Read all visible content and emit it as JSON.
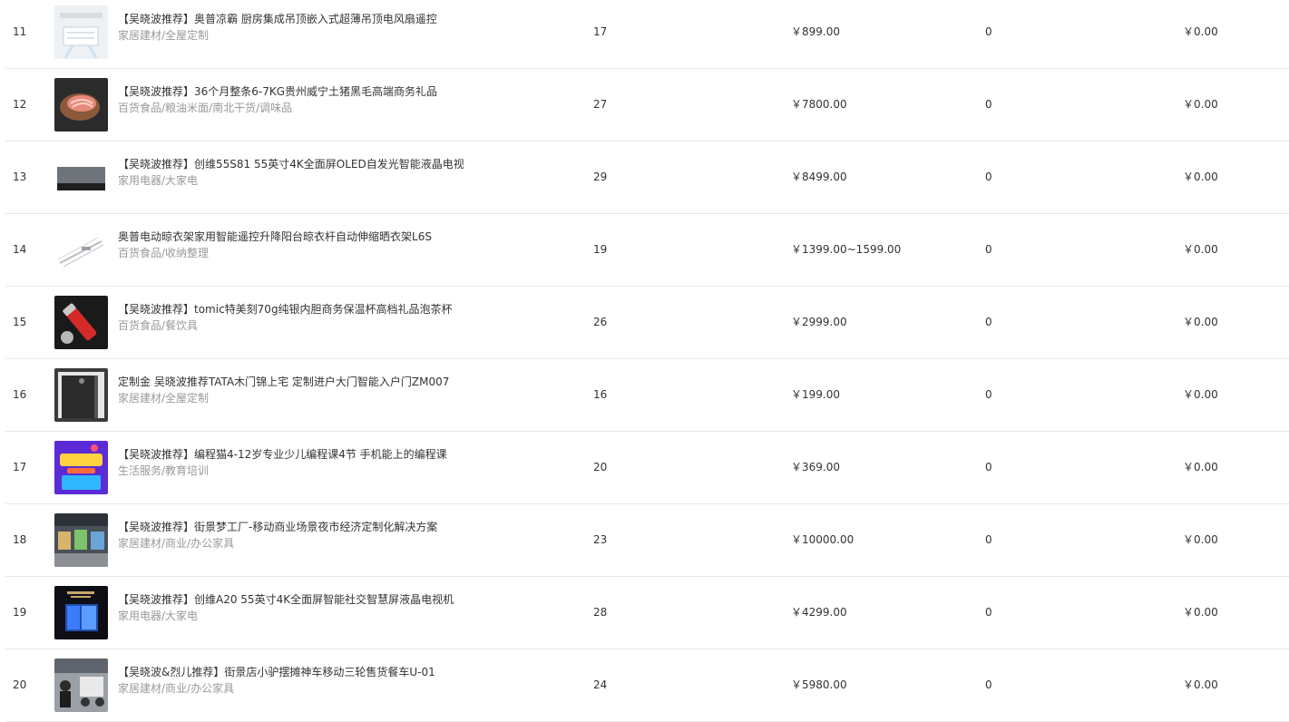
{
  "rows": [
    {
      "index": "11",
      "thumb_icon": "ceiling-fan-product-image",
      "name": "【吴晓波推荐】奥普凉霸 厨房集成吊顶嵌入式超薄吊顶电风扇遥控",
      "category": "家居建材/全屋定制",
      "stock": "17",
      "price": "￥899.00",
      "sales": "0",
      "amount": "￥0.00"
    },
    {
      "index": "12",
      "thumb_icon": "pork-product-image",
      "name": "【吴晓波推荐】36个月整条6-7KG贵州威宁土猪黑毛高端商务礼品",
      "category": "百货食品/粮油米面/南北干货/调味品",
      "stock": "27",
      "price": "￥7800.00",
      "sales": "0",
      "amount": "￥0.00"
    },
    {
      "index": "13",
      "thumb_icon": "tv-product-image",
      "name": "【吴晓波推荐】创维55S81 55英寸4K全面屏OLED自发光智能液晶电视",
      "category": "家用电器/大家电",
      "stock": "29",
      "price": "￥8499.00",
      "sales": "0",
      "amount": "￥0.00"
    },
    {
      "index": "14",
      "thumb_icon": "clothes-rack-product-image",
      "name": "奥普电动晾衣架家用智能遥控升降阳台晾衣杆自动伸缩晒衣架L6S",
      "category": "百货食品/收纳整理",
      "stock": "19",
      "price": "￥1399.00~1599.00",
      "sales": "0",
      "amount": "￥0.00"
    },
    {
      "index": "15",
      "thumb_icon": "thermos-product-image",
      "name": "【吴晓波推荐】tomic特美刻70g纯银内胆商务保温杯高档礼品泡茶杯",
      "category": "百货食品/餐饮具",
      "stock": "26",
      "price": "￥2999.00",
      "sales": "0",
      "amount": "￥0.00"
    },
    {
      "index": "16",
      "thumb_icon": "door-product-image",
      "name": "定制金 吴晓波推荐TATA木门锦上宅 定制进户大门智能入户门ZM007",
      "category": "家居建材/全屋定制",
      "stock": "16",
      "price": "￥199.00",
      "sales": "0",
      "amount": "￥0.00"
    },
    {
      "index": "17",
      "thumb_icon": "coding-course-product-image",
      "name": "【吴晓波推荐】编程猫4-12岁专业少儿编程课4节 手机能上的编程课",
      "category": "生活服务/教育培训",
      "stock": "20",
      "price": "￥369.00",
      "sales": "0",
      "amount": "￥0.00"
    },
    {
      "index": "18",
      "thumb_icon": "street-market-product-image",
      "name": "【吴晓波推荐】街景梦工厂-移动商业场景夜市经济定制化解决方案",
      "category": "家居建材/商业/办公家具",
      "stock": "23",
      "price": "￥10000.00",
      "sales": "0",
      "amount": "￥0.00"
    },
    {
      "index": "19",
      "thumb_icon": "smart-tv-product-image",
      "name": "【吴晓波推荐】创维A20 55英寸4K全面屏智能社交智慧屏液晶电视机",
      "category": "家用电器/大家电",
      "stock": "28",
      "price": "￥4299.00",
      "sales": "0",
      "amount": "￥0.00"
    },
    {
      "index": "20",
      "thumb_icon": "food-cart-product-image",
      "name": "【吴晓波&烈儿推荐】街景店小驴摆摊神车移动三轮售货餐车U-01",
      "category": "家居建材/商业/办公家具",
      "stock": "24",
      "price": "￥5980.00",
      "sales": "0",
      "amount": "￥0.00"
    }
  ]
}
